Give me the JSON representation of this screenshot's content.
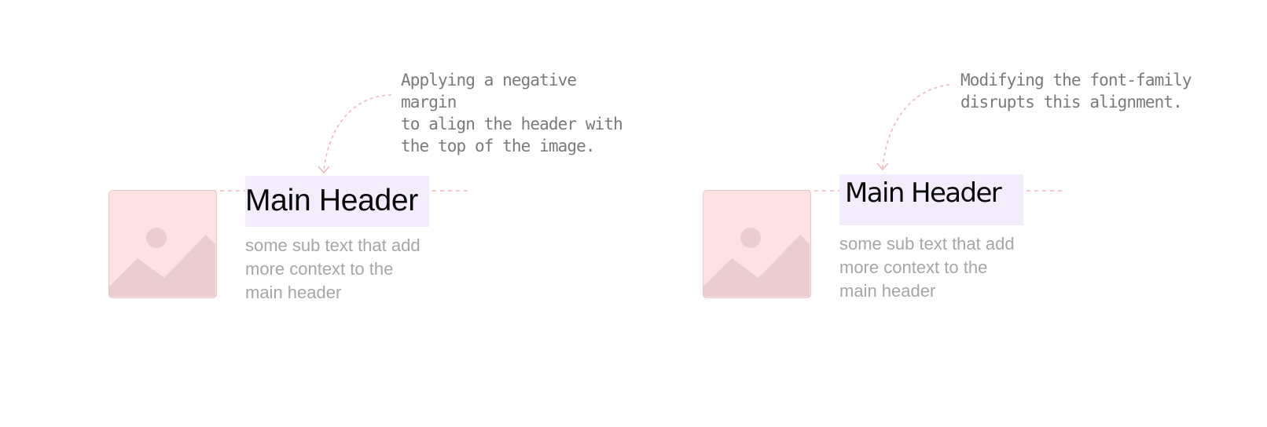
{
  "examples": [
    {
      "header": "Main Header",
      "sub_text": "some sub text that add\nmore context to the\nmain header",
      "annotation": "Applying a negative margin\nto align the header with\nthe top of the image."
    },
    {
      "header": "Main Header",
      "sub_text": "some sub text that add\nmore context to the\nmain header",
      "annotation": "Modifying the font-family\ndisrupts this alignment."
    }
  ],
  "colors": {
    "placeholder_fill": "#fde2e4",
    "placeholder_shape": "#ebcdd0",
    "header_highlight": "#f2ecfd",
    "guide_line": "#f1b8bc",
    "sub_text": "#a6a6a6",
    "annotation_text": "#7a7a7a"
  },
  "icons": [
    "image-placeholder-icon",
    "curved-arrow-icon"
  ]
}
